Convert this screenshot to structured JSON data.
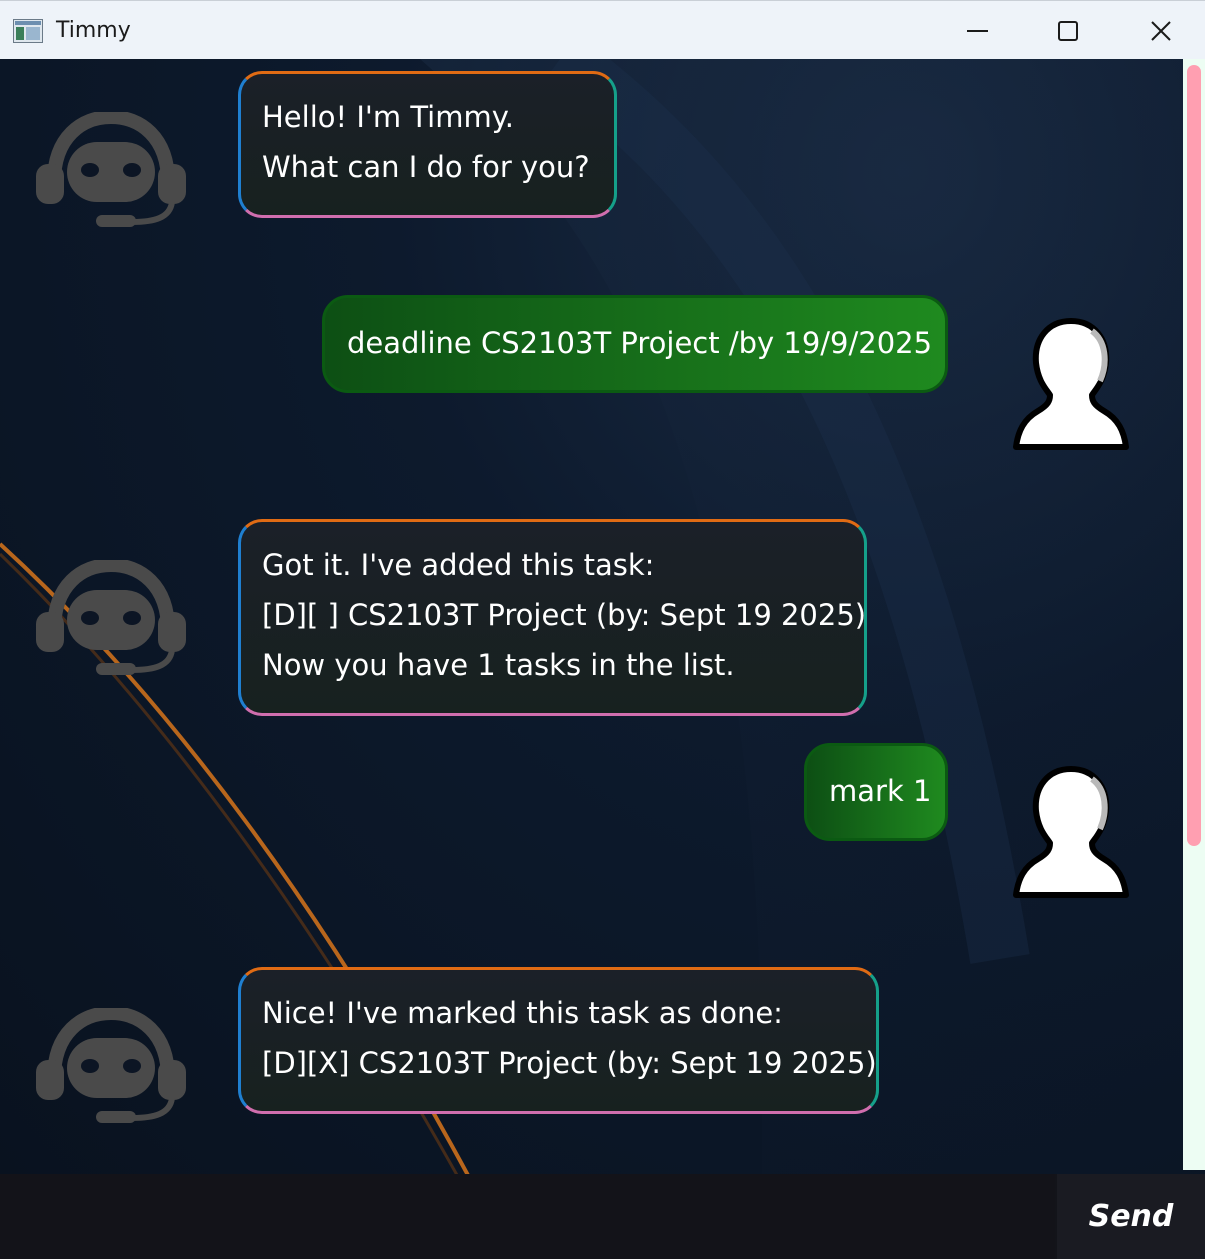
{
  "window": {
    "title": "Timmy",
    "app_icon": "window-app-icon",
    "controls": {
      "minimize_icon": "minimize-icon",
      "maximize_icon": "maximize-icon",
      "close_icon": "close-icon"
    }
  },
  "messages": [
    {
      "sender": "bot",
      "avatar_icon": "headset-bot-icon",
      "lines": [
        "Hello! I'm Timmy.",
        "What can I do for you?"
      ]
    },
    {
      "sender": "user",
      "avatar_icon": "user-silhouette-icon",
      "text": "deadline CS2103T Project /by 19/9/2025"
    },
    {
      "sender": "bot",
      "avatar_icon": "headset-bot-icon",
      "lines": [
        "Got it. I've added this task:",
        "[D][ ] CS2103T Project (by: Sept 19 2025)",
        "Now you have 1 tasks in the list."
      ]
    },
    {
      "sender": "user",
      "avatar_icon": "user-silhouette-icon",
      "text": "mark 1"
    },
    {
      "sender": "bot",
      "avatar_icon": "headset-bot-icon",
      "lines": [
        "Nice! I've marked this task as done:",
        "[D][X] CS2103T Project (by: Sept 19 2025)"
      ]
    }
  ],
  "input": {
    "value": "",
    "placeholder": ""
  },
  "send_button": {
    "label": "Send"
  },
  "colors": {
    "bot_border_top": "#e06b14",
    "bot_border_right": "#15a08a",
    "bot_border_bottom": "#d06eae",
    "bot_border_left": "#1f7fd0",
    "user_bubble_start": "#0d4f14",
    "user_bubble_end": "#1f8a1f",
    "scrollbar_thumb": "#ff9fb1",
    "scrollbar_track": "#edfdf3"
  }
}
